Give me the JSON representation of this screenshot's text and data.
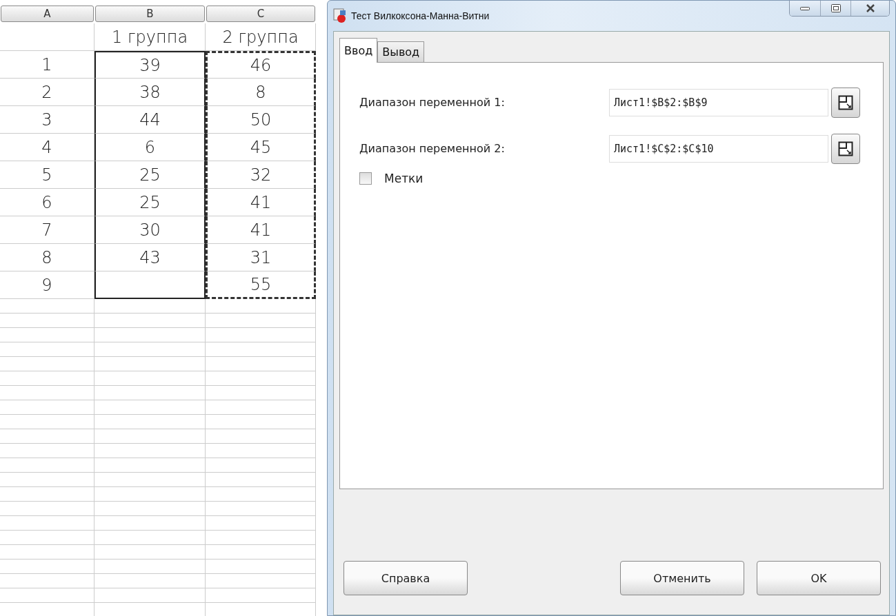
{
  "sheet": {
    "columns": [
      {
        "label": "A",
        "kind": "plain"
      },
      {
        "label": "B",
        "kind": "solid"
      },
      {
        "label": "C",
        "kind": "dashed"
      }
    ],
    "header_row": [
      "1 группа",
      "2 группа"
    ],
    "rows": [
      [
        "1",
        "39",
        "46"
      ],
      [
        "2",
        "38",
        "8"
      ],
      [
        "3",
        "44",
        "50"
      ],
      [
        "4",
        "6",
        "45"
      ],
      [
        "5",
        "25",
        "32"
      ],
      [
        "6",
        "25",
        "41"
      ],
      [
        "7",
        "30",
        "41"
      ],
      [
        "8",
        "43",
        "31"
      ],
      [
        "9",
        null,
        "55"
      ]
    ]
  },
  "dialog": {
    "title": "Тест Вилкоксона-Манна-Витни",
    "tabs": [
      {
        "label": "Ввод",
        "selected": true
      },
      {
        "label": "Вывод",
        "selected": false
      }
    ],
    "fields": [
      {
        "label": "Диапазон переменной 1:",
        "value": "Лист1!$B$2:$B$9"
      },
      {
        "label": "Диапазон переменной 2:",
        "value": "Лист1!$C$2:$C$10"
      }
    ],
    "checkbox": {
      "label": "Метки",
      "checked": false
    },
    "buttons": {
      "left": [
        "Справка"
      ],
      "right": [
        "Отменить",
        "OK"
      ]
    }
  }
}
